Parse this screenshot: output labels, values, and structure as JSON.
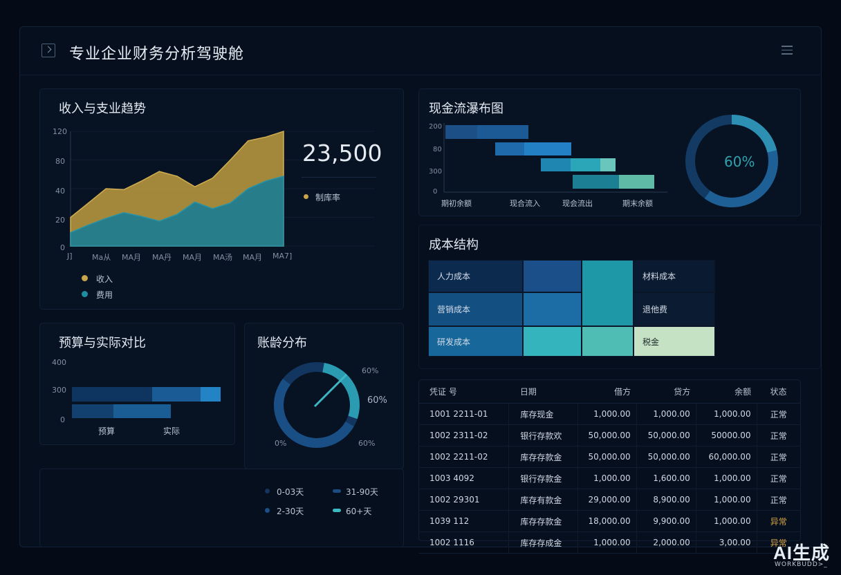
{
  "header": {
    "title": "专业企业财务分析驾驶舱",
    "logo_icon": "terminal-icon",
    "menu_icon": "menu-icon"
  },
  "trend": {
    "title": "收入与支业趋势",
    "kpi": "23,500",
    "kpi_legend": "制库率",
    "yticks": [
      "120",
      "80",
      "40",
      "20",
      "0"
    ],
    "xticks": [
      "J]",
      "Ma从",
      "MA月",
      "MA丹",
      "MA月",
      "MA汤",
      "MA月",
      "MA7]"
    ],
    "legend": [
      {
        "name": "收入",
        "color": "#c9a54a"
      },
      {
        "name": "费用",
        "color": "#1e8da0"
      }
    ],
    "chart_data": {
      "type": "area",
      "ylim": [
        0,
        120
      ],
      "series": [
        {
          "name": "收入",
          "values": [
            30,
            45,
            60,
            59,
            68,
            78,
            73,
            62,
            71,
            90,
            110,
            114,
            120
          ]
        },
        {
          "name": "费用",
          "values": [
            14,
            22,
            29,
            35,
            31,
            26,
            33,
            46,
            39,
            45,
            60,
            68,
            73
          ]
        }
      ]
    }
  },
  "waterfall": {
    "title": "现金流瀑布图",
    "yticks": [
      "200",
      "80",
      "300",
      "0"
    ],
    "xticks": [
      "期初余额",
      "现合流入",
      "现会流出",
      "期末余额"
    ],
    "donut_label": "60%",
    "chart_data": {
      "type": "bar",
      "categories": [
        "期初余额",
        "现合流入",
        "现会流出",
        "期末余额"
      ],
      "donut_percent": 60
    }
  },
  "cost": {
    "title": "成本结构",
    "items": [
      "人力成本",
      "材料成本",
      "营销成本",
      "退他费",
      "研发成本",
      "税金"
    ]
  },
  "budget": {
    "title": "预算与实际对比",
    "yticks": [
      "400",
      "300",
      "0"
    ],
    "xticks": [
      "预算",
      "实际"
    ]
  },
  "aging": {
    "title": "账龄分布",
    "labels": [
      "60%",
      "60%",
      "0%",
      "60%"
    ],
    "legend": [
      "0-03天",
      "31-90天",
      "2-30天",
      "60+天"
    ]
  },
  "table": {
    "headers": [
      "凭证  号",
      "日期",
      "借方",
      "贷方",
      "余额",
      "状态"
    ],
    "rows": [
      [
        "1001  2211-01",
        "库存现金",
        "1,000.00",
        "1,000.00",
        "1,000.00",
        "正常"
      ],
      [
        "1002  2311-02",
        "银行存款欢",
        "50,000.00",
        "50,000.00",
        "50000.00",
        "正常"
      ],
      [
        "1002  2211-02",
        "库存存款金",
        "50,000.00",
        "50,000.00",
        "60,000.00",
        "正常"
      ],
      [
        "1003  4092",
        "银行存款金",
        "1,000.00",
        "1,600.00",
        "1,000.00",
        "正常"
      ],
      [
        "1002  29301",
        "库存有款金",
        "29,000.00",
        "8,900.00",
        "1,000.00",
        "正常"
      ],
      [
        "1039  112",
        "库存存款金",
        "18,000.00",
        "9,900.00",
        "1,000.00",
        "异常"
      ],
      [
        "1002  1116",
        "库存存成金",
        "1,000.00",
        "2,000.00",
        "3,00.00",
        "异常"
      ]
    ]
  },
  "watermark": {
    "main": "AI生成",
    "sub": "WORKBUDD>_"
  }
}
